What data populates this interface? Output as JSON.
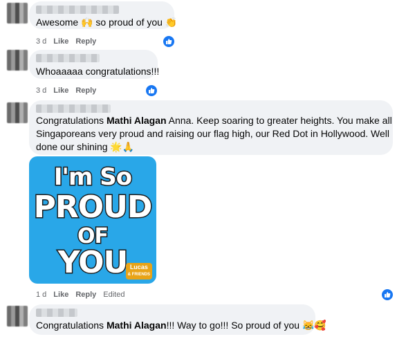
{
  "comments": [
    {
      "text_parts": [
        "Awesome ",
        " so proud of you "
      ],
      "emojis": [
        "🙌",
        "👏"
      ],
      "time": "3 d",
      "like_label": "Like",
      "reply_label": "Reply"
    },
    {
      "text": "Whoaaaaa congratulations!!!",
      "time": "3 d",
      "like_label": "Like",
      "reply_label": "Reply"
    },
    {
      "text_pre": "Congratulations ",
      "mention": "Mathi Alagan",
      "line1_rest": " Anna. Keep soaring to greater heights. You make all",
      "line2": "Singaporeans very proud and raising our flag high, our Red Dot in Hollywood. Well",
      "line3": "done our shining ",
      "emojis": [
        "🌟",
        "🙏"
      ],
      "sticker": {
        "line1": "I'm So",
        "line2": "PROUD",
        "line3": "OF",
        "line4": "YOU",
        "brand_line1": "Lucas",
        "brand_line2": "& FRIENDS"
      },
      "time": "1 d",
      "like_label": "Like",
      "reply_label": "Reply",
      "status": "Edited"
    },
    {
      "text_pre": "Congratulations ",
      "mention": "Mathi Alagan",
      "text_post": "!!! Way to go!!! So proud of you ",
      "emojis": [
        "😹",
        "🥰"
      ]
    }
  ],
  "icons": {
    "like_badge": "thumbs-up-icon",
    "accent": "#1877f2"
  }
}
